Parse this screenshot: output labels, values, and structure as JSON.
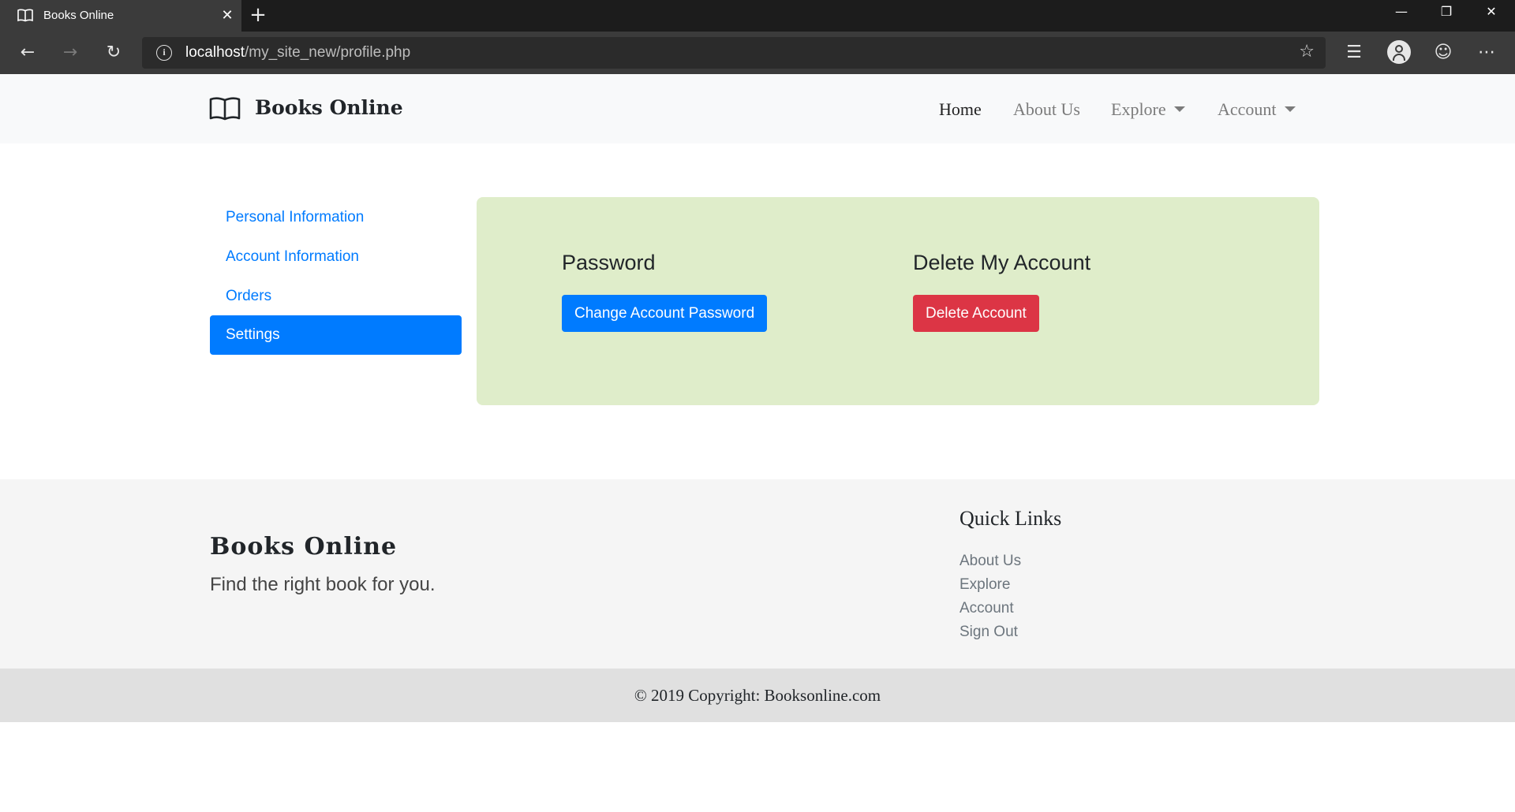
{
  "browser": {
    "tab_title": "Books Online",
    "url_host": "localhost",
    "url_path": "/my_site_new/profile.php"
  },
  "navbar": {
    "brand": "Books Online",
    "links": [
      "Home",
      "About Us",
      "Explore",
      "Account"
    ]
  },
  "sidebar": {
    "items": [
      "Personal Information",
      "Account Information",
      "Orders",
      "Settings"
    ],
    "active": "Settings"
  },
  "settings": {
    "password_heading": "Password",
    "password_button": "Change Account Password",
    "delete_heading": "Delete My Account",
    "delete_button": "Delete Account"
  },
  "footer": {
    "brand": "Books Online",
    "tagline": "Find the right book for you.",
    "quick_links_title": "Quick Links",
    "quick_links": [
      "About Us",
      "Explore",
      "Account",
      "Sign Out"
    ],
    "copyright": "© 2019 Copyright: Booksonline.com"
  },
  "colors": {
    "primary": "#007bff",
    "danger": "#dc3545",
    "card_bg": "#dfedca"
  }
}
